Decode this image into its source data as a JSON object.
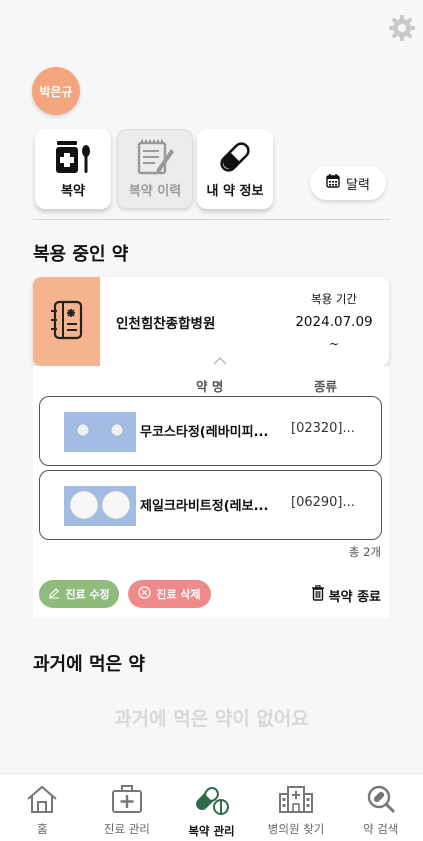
{
  "user": {
    "name": "박은규"
  },
  "tiles": [
    {
      "label": "복약",
      "icon": "medicine-bottle-icon"
    },
    {
      "label": "복약 이력",
      "icon": "notepad-history-icon"
    },
    {
      "label": "내 약 정보",
      "icon": "capsule-icon"
    }
  ],
  "calendar_button": {
    "label": "달력",
    "icon": "calendar-icon"
  },
  "current_section": {
    "title": "복용 중인 약",
    "card": {
      "hospital": "인천힘찬종합병원",
      "period_label": "복용 기간",
      "period_start": "2024.07.09",
      "period_end": "~"
    },
    "columns": {
      "name": "약 명",
      "type": "종류"
    },
    "medications": [
      {
        "name": "무코스타정(레바미피...",
        "code": "[02320]..."
      },
      {
        "name": "제일크라비트정(레보...",
        "code": "[06290]..."
      }
    ],
    "total": "총 2개",
    "edit_label": "진료 수정",
    "delete_label": "진료 삭제",
    "end_label": "복약 종료"
  },
  "past_section": {
    "title": "과거에 먹은 약",
    "empty_message": "과거에 먹은 약이 없어요"
  },
  "nav": [
    {
      "label": "홈",
      "icon": "home-icon"
    },
    {
      "label": "진료 관리",
      "icon": "medical-bag-icon"
    },
    {
      "label": "복약 관리",
      "icon": "pill-icon",
      "active": true
    },
    {
      "label": "병의원 찾기",
      "icon": "hospital-icon"
    },
    {
      "label": "약 검색",
      "icon": "search-icon"
    }
  ],
  "colors": {
    "accent": "#f3a57e",
    "edit": "#8fbb7c",
    "delete": "#ef8a8a",
    "active_nav": "#2f6b4a"
  }
}
